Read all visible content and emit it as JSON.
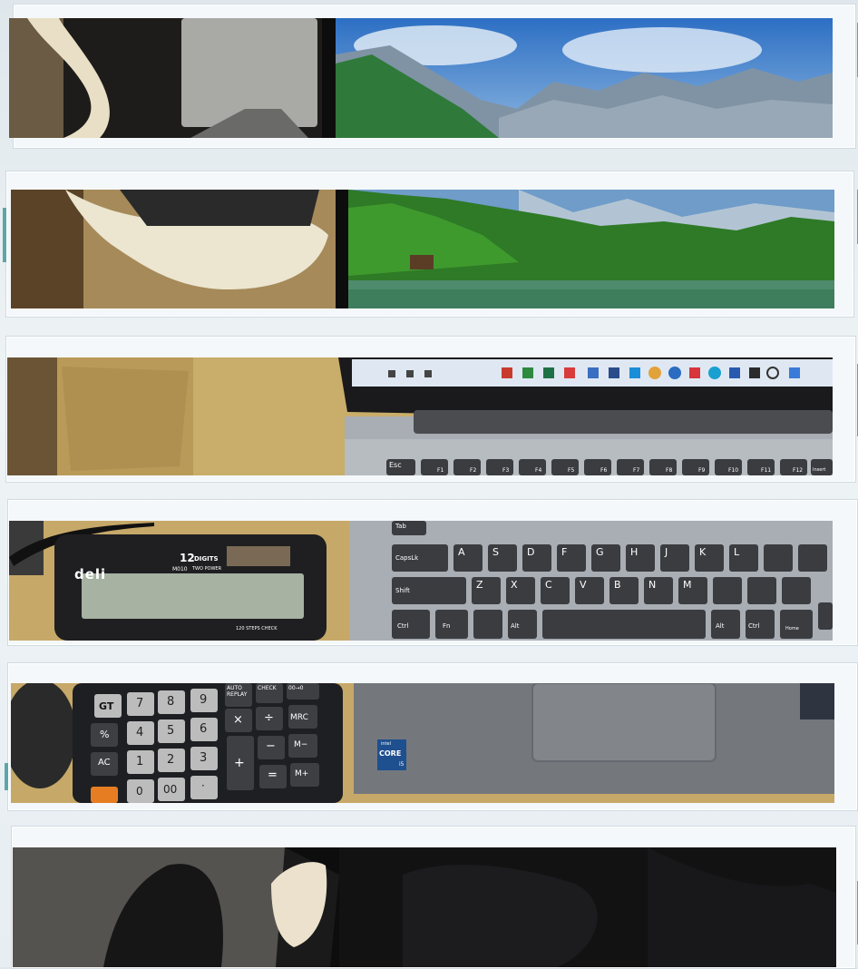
{
  "photo_text": {
    "calculator_brand": "deli",
    "calculator_digits_big": "12",
    "calculator_digits_word": "DIGITS",
    "calculator_model": "M010",
    "calculator_power": "TWO POWER",
    "calculator_steps": "120 STEPS CHECK",
    "keys_top": [
      "GT",
      "7",
      "8",
      "9",
      "AUTO REPLAY",
      "CHECK",
      "00→0"
    ],
    "keys_row2": [
      "%",
      "4",
      "5",
      "6",
      "×",
      "÷",
      "MRC"
    ],
    "keys_row3": [
      "AC",
      "1",
      "2",
      "3",
      "+",
      "−",
      "M−"
    ],
    "keys_row4": [
      "0",
      "00",
      "·",
      "=",
      "M+"
    ],
    "laptop_keys_fn": [
      "Esc",
      "F1",
      "F2",
      "F3",
      "F4",
      "F5",
      "F6",
      "F7",
      "F8",
      "F9",
      "F10",
      "F11",
      "F12",
      "Insert"
    ],
    "laptop_keys_left": [
      "Tab",
      "CapsLk",
      "Shift",
      "Ctrl",
      "Fn",
      "Alt"
    ],
    "laptop_keys_letters_row1": [
      "A",
      "S",
      "D",
      "F",
      "G",
      "H",
      "J",
      "K",
      "L"
    ],
    "laptop_keys_letters_row2": [
      "Z",
      "X",
      "C",
      "V",
      "B",
      "N",
      "M"
    ],
    "laptop_keys_right": [
      "Alt",
      "Ctrl",
      "Home"
    ],
    "intel_badge_line1": "intel",
    "intel_badge_line2": "CORE",
    "intel_badge_line3": "i5"
  },
  "colors": {
    "frame_accent": "#5fa5a8",
    "sky": "#3e7fc8",
    "forest": "#2f7a2a",
    "desk": "#c9ad6a",
    "laptop_silver": "#a9aeb4",
    "keyboard_key": "#3a3c40"
  }
}
